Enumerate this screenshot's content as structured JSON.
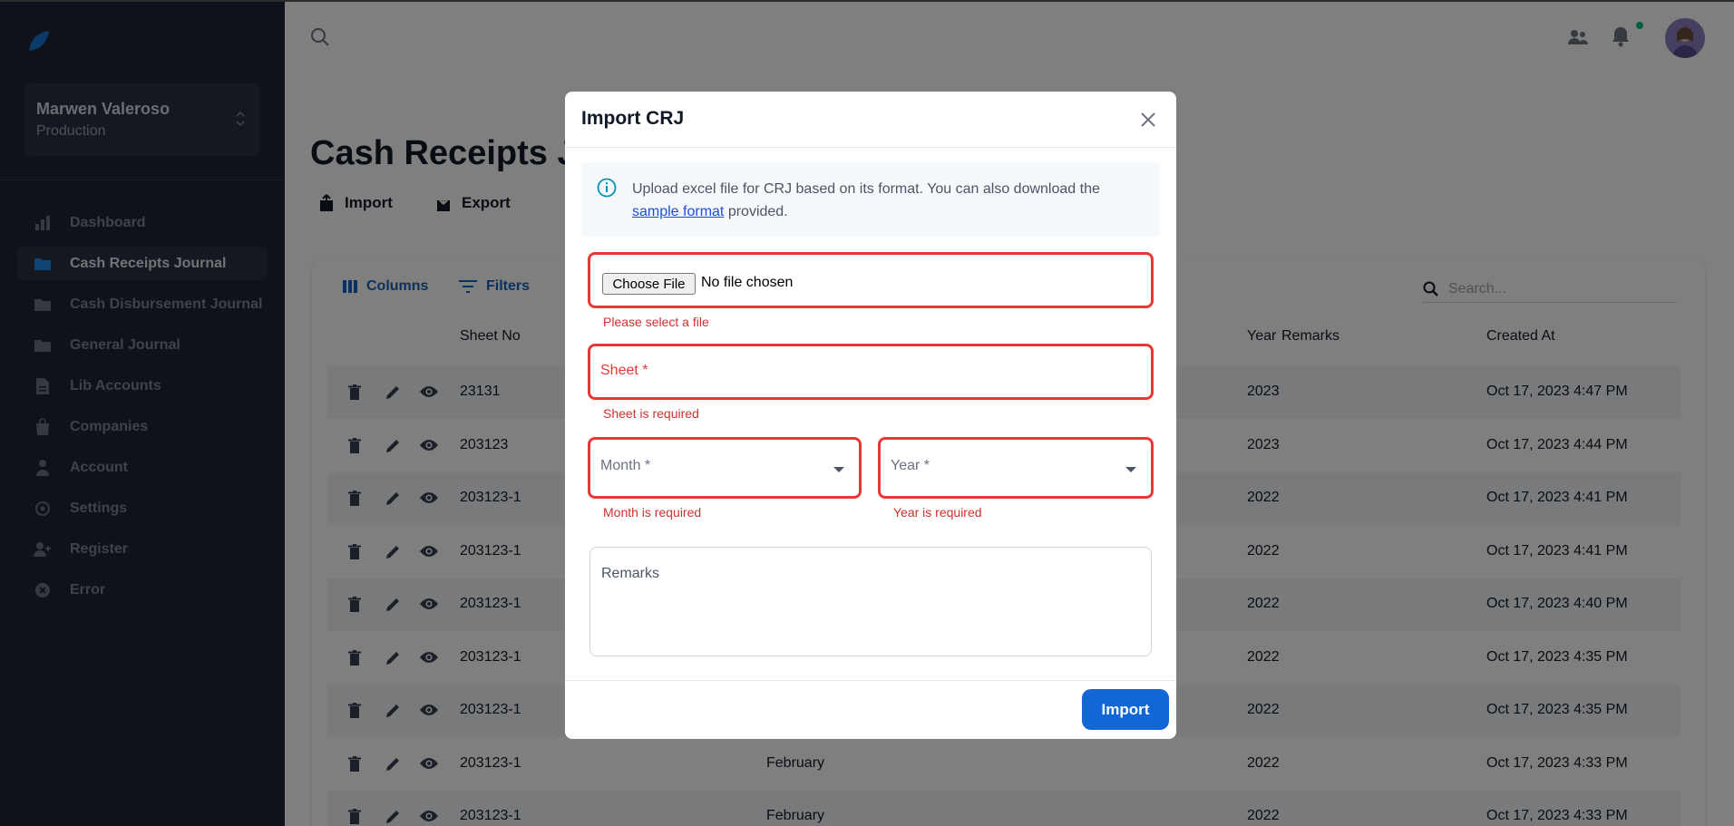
{
  "sidebar": {
    "account_name": "Marwen Valeroso",
    "account_env": "Production",
    "items": [
      {
        "label": "Dashboard",
        "icon": "bar-chart-icon"
      },
      {
        "label": "Cash Receipts Journal",
        "icon": "folder-icon",
        "active": true
      },
      {
        "label": "Cash Disbursement Journal",
        "icon": "folder-icon"
      },
      {
        "label": "General Journal",
        "icon": "folder-icon"
      },
      {
        "label": "Lib Accounts",
        "icon": "document-icon"
      },
      {
        "label": "Companies",
        "icon": "shopping-bag-icon"
      },
      {
        "label": "Account",
        "icon": "user-icon"
      },
      {
        "label": "Settings",
        "icon": "gear-icon"
      },
      {
        "label": "Register",
        "icon": "user-plus-icon"
      },
      {
        "label": "Error",
        "icon": "x-circle-icon"
      }
    ]
  },
  "page": {
    "title": "Cash Receipts Journal",
    "import_label": "Import",
    "export_label": "Export"
  },
  "table": {
    "columns_label": "Columns",
    "filters_label": "Filters",
    "search_placeholder": "Search...",
    "headers": {
      "sheet_no": "Sheet No",
      "year": "Year",
      "remarks": "Remarks",
      "created_at": "Created At"
    },
    "rows": [
      {
        "sheet_no": "23131",
        "month": "",
        "year": "2023",
        "created_at": "Oct 17, 2023 4:47 PM"
      },
      {
        "sheet_no": "203123",
        "month": "",
        "year": "2023",
        "created_at": "Oct 17, 2023 4:44 PM"
      },
      {
        "sheet_no": "203123-1",
        "month": "",
        "year": "2022",
        "created_at": "Oct 17, 2023 4:41 PM"
      },
      {
        "sheet_no": "203123-1",
        "month": "",
        "year": "2022",
        "created_at": "Oct 17, 2023 4:41 PM"
      },
      {
        "sheet_no": "203123-1",
        "month": "",
        "year": "2022",
        "created_at": "Oct 17, 2023 4:40 PM"
      },
      {
        "sheet_no": "203123-1",
        "month": "",
        "year": "2022",
        "created_at": "Oct 17, 2023 4:35 PM"
      },
      {
        "sheet_no": "203123-1",
        "month": "",
        "year": "2022",
        "created_at": "Oct 17, 2023 4:35 PM"
      },
      {
        "sheet_no": "203123-1",
        "month": "February",
        "year": "2022",
        "created_at": "Oct 17, 2023 4:33 PM"
      },
      {
        "sheet_no": "203123-1",
        "month": "February",
        "year": "2022",
        "created_at": "Oct 17, 2023 4:33 PM"
      }
    ]
  },
  "modal": {
    "title": "Import CRJ",
    "info_text_before": "Upload excel file for CRJ based on its format. You can also download the ",
    "info_link": "sample format",
    "info_text_after": " provided.",
    "file": {
      "button": "Choose File",
      "status": "No file chosen",
      "error": "Please select a file"
    },
    "sheet": {
      "label": "Sheet *",
      "error": "Sheet is required"
    },
    "month": {
      "label": "Month *",
      "error": "Month is required"
    },
    "year": {
      "label": "Year *",
      "error": "Year is required"
    },
    "remarks": {
      "label": "Remarks"
    },
    "submit_label": "Import"
  },
  "colors": {
    "accent": "#1366d6",
    "error": "#e53935",
    "sidebar_bg": "#1c2536"
  }
}
